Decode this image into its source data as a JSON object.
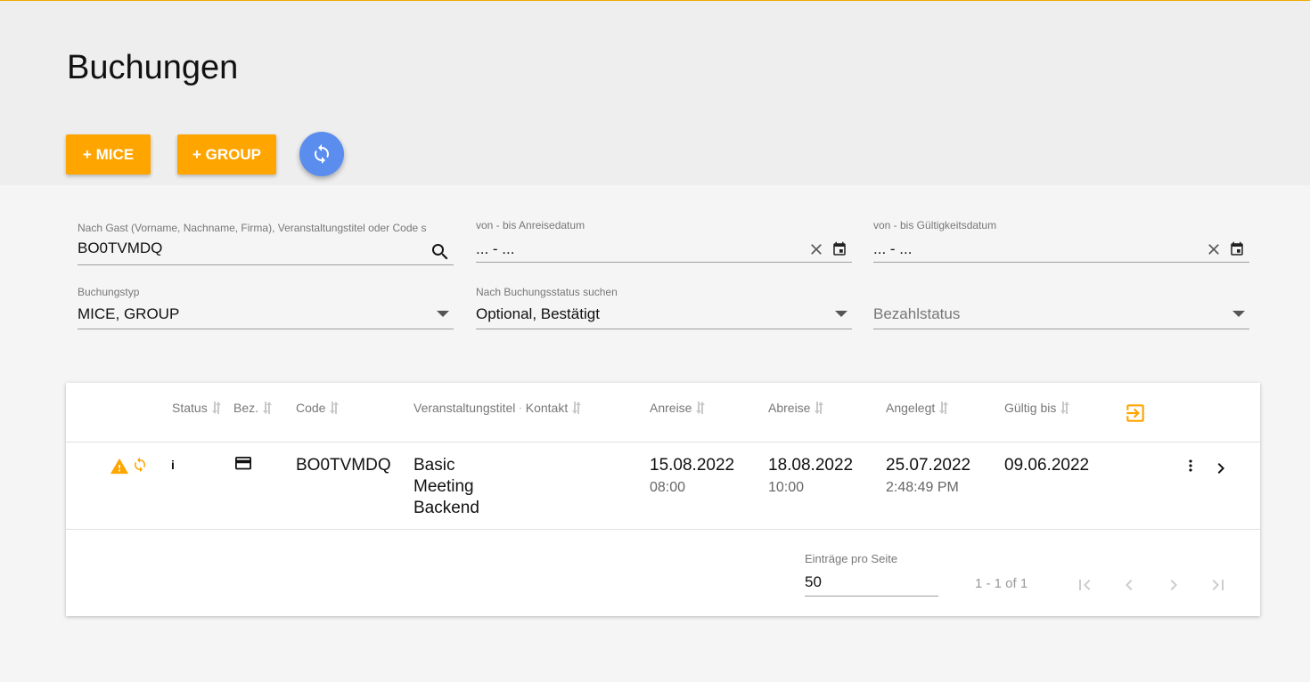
{
  "page": {
    "title": "Buchungen"
  },
  "actions": {
    "mice_label": "+ MICE",
    "group_label": "+ GROUP",
    "refresh_icon": "sync-icon"
  },
  "filters": {
    "guest_search": {
      "label": "Nach Gast (Vorname, Nachname, Firma), Veranstaltungstitel oder Code s",
      "value": "BO0TVMDQ"
    },
    "arrival_range": {
      "label": "von - bis Anreisedatum",
      "value": "... - ..."
    },
    "validity_range": {
      "label": "von - bis Gültigkeitsdatum",
      "value": "... - ..."
    },
    "booking_type": {
      "label": "Buchungstyp",
      "value": "MICE, GROUP"
    },
    "booking_status": {
      "label": "Nach Buchungsstatus suchen",
      "value": "Optional, Bestätigt"
    },
    "payment_status": {
      "placeholder": "Bezahlstatus"
    }
  },
  "table": {
    "headers": {
      "status": "Status",
      "bez": "Bez.",
      "code": "Code",
      "title": "Veranstaltungstitel",
      "contact": "Kontakt",
      "arrival": "Anreise",
      "departure": "Abreise",
      "created": "Angelegt",
      "valid_until": "Gültig bis"
    },
    "rows": [
      {
        "status_info": "i",
        "code": "BO0TVMDQ",
        "title_lines": [
          "Basic",
          "Meeting",
          "Backend"
        ],
        "arrival_date": "15.08.2022",
        "arrival_time": "08:00",
        "departure_date": "18.08.2022",
        "departure_time": "10:00",
        "created_date": "25.07.2022",
        "created_time": "2:48:49 PM",
        "valid_until": "09.06.2022"
      }
    ]
  },
  "pagination": {
    "label": "Einträge pro Seite",
    "page_size": "50",
    "range": "1 - 1 of 1"
  },
  "colors": {
    "accent": "#ffa500",
    "fab": "#5b8def",
    "topline": "#f2a900"
  }
}
